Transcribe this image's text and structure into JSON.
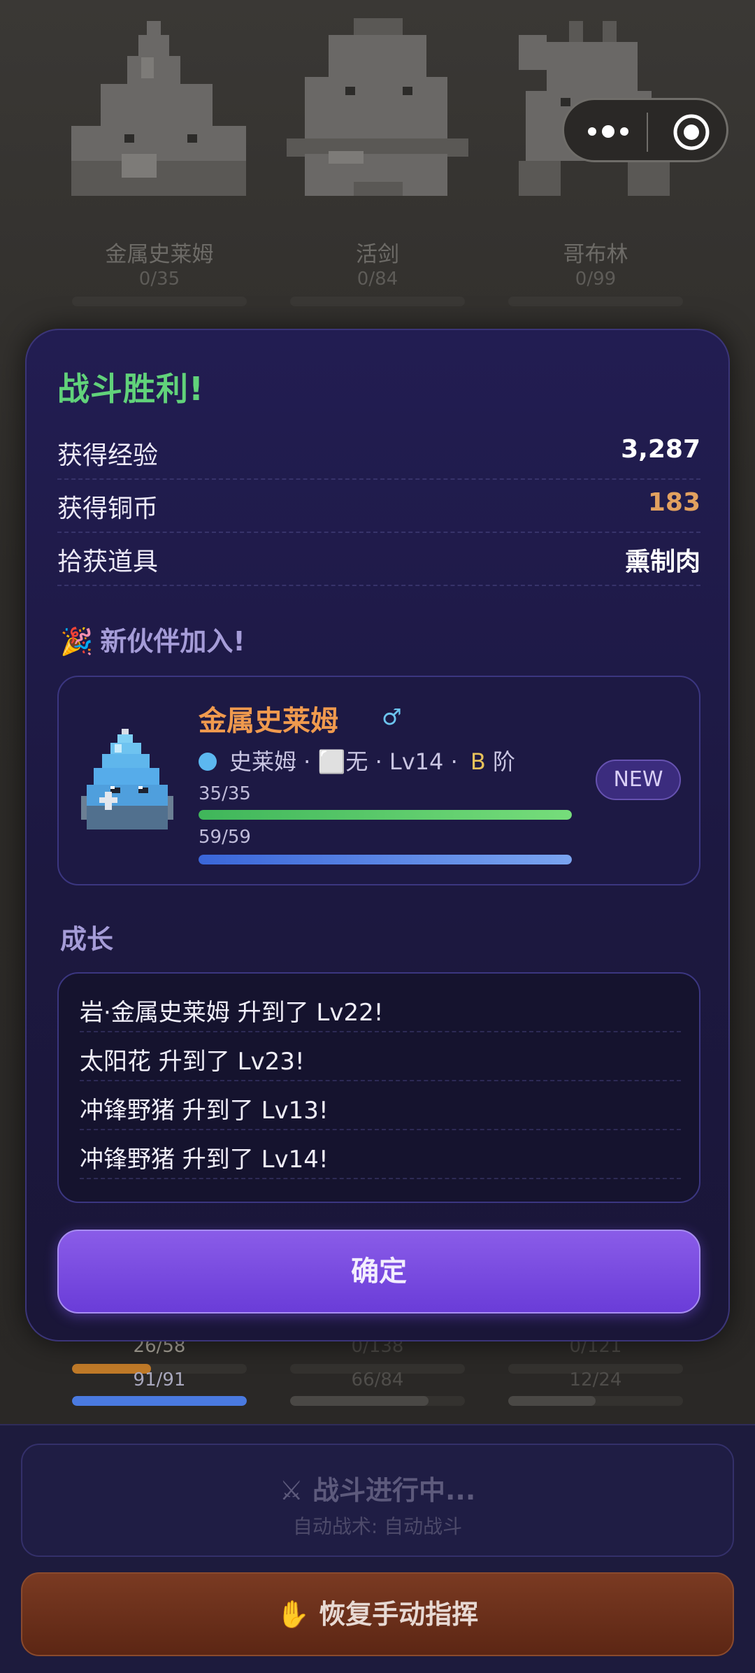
{
  "enemies": [
    {
      "name": "金属史莱姆",
      "hp": "0/35"
    },
    {
      "name": "活剑",
      "hp": "0/84"
    },
    {
      "name": "哥布林",
      "hp": "0/99"
    }
  ],
  "party_stats": [
    {
      "hp": "26/58",
      "mp": "91/91",
      "hp_fill": 0.45,
      "mp_fill": 1.0
    },
    {
      "hp": "0/138",
      "mp": "66/84",
      "hp_fill": 0.0,
      "mp_fill": 0.79
    },
    {
      "hp": "0/121",
      "mp": "12/24",
      "hp_fill": 0.0,
      "mp_fill": 0.5
    }
  ],
  "modal": {
    "title": "战斗胜利!",
    "rows": [
      {
        "label": "获得经验",
        "value": "3,287"
      },
      {
        "label": "获得铜币",
        "value": "183"
      },
      {
        "label": "拾获道具",
        "value": "熏制肉"
      }
    ],
    "new_partner_emoji": "🎉",
    "new_partner_heading": "新伙伴加入!",
    "partner": {
      "name": "金属史莱姆",
      "gender": "♂",
      "species": "史莱姆 ·",
      "equipment": "⬜无",
      "level": "· Lv14 ·",
      "grade": "B",
      "grade_suffix": "阶",
      "hp_text": "35/35",
      "hp_fill": 1.0,
      "mp_text": "59/59",
      "mp_fill": 1.0,
      "badge": "NEW"
    },
    "growth_heading": "成长",
    "growth": [
      "岩·金属史莱姆 升到了 Lv22!",
      "太阳花 升到了 Lv23!",
      "冲锋野猪 升到了 Lv13!",
      "冲锋野猪 升到了 Lv14!"
    ],
    "confirm_label": "确定"
  },
  "bottom": {
    "battle_title": "⚔ 战斗进行中...",
    "battle_sub": "自动战术: 自动战斗",
    "resume_label": "✋ 恢复手动指挥"
  },
  "colors": {
    "victory_green": "#61d27a",
    "coin_orange": "#e2a15f",
    "partner_orange": "#f09a4e",
    "confirm_purple": "#7a4ae0",
    "resume_brown": "#6a2e1a"
  }
}
